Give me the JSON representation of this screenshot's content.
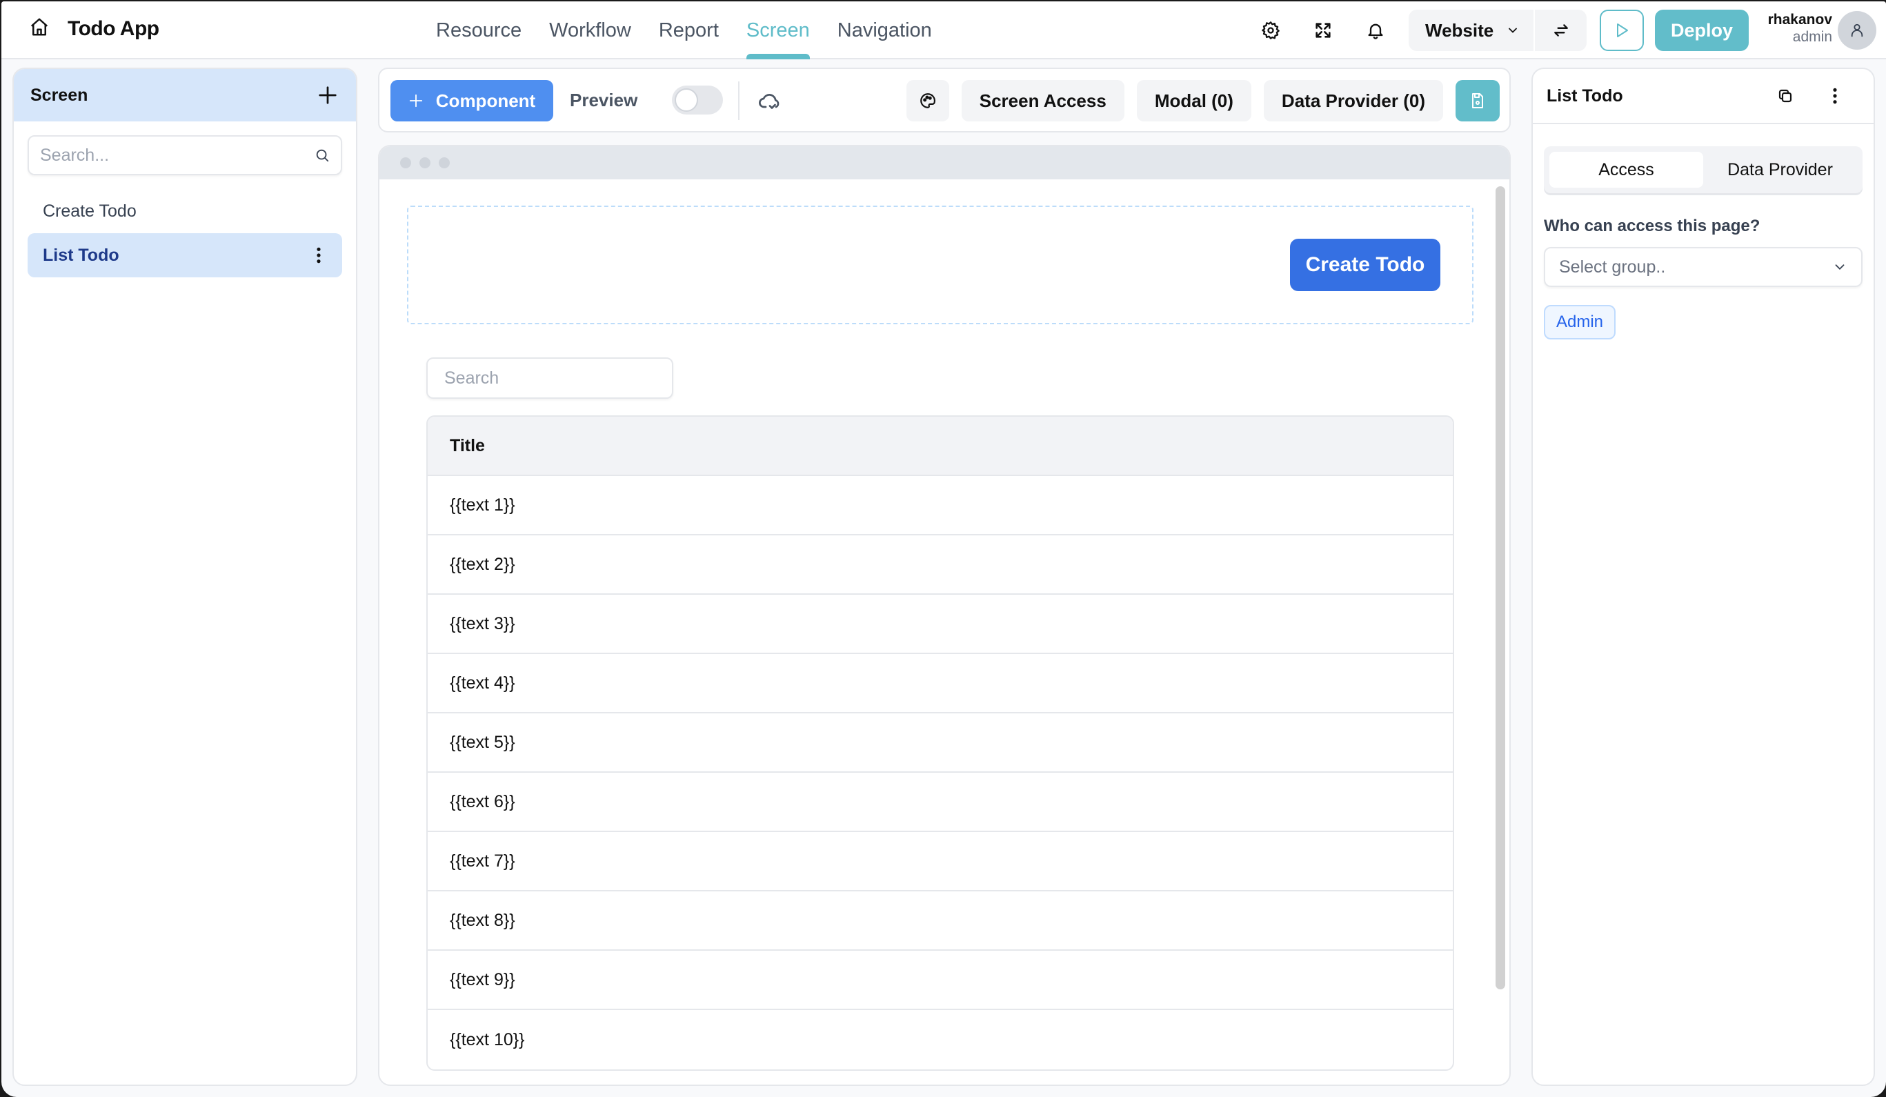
{
  "app": {
    "title": "Todo App",
    "home_icon": "home-icon"
  },
  "nav": {
    "items": [
      {
        "label": "Resource",
        "active": false
      },
      {
        "label": "Workflow",
        "active": false
      },
      {
        "label": "Report",
        "active": false
      },
      {
        "label": "Screen",
        "active": true
      },
      {
        "label": "Navigation",
        "active": false
      }
    ]
  },
  "topbar": {
    "icons": [
      "gear-icon",
      "expand-icon",
      "bell-icon"
    ],
    "environment": "Website",
    "swap_icon": "swap-arrows-icon",
    "run_icon": "play-icon",
    "deploy_label": "Deploy",
    "user": {
      "name": "rhakanov",
      "role": "admin"
    }
  },
  "left_panel": {
    "title": "Screen",
    "search_placeholder": "Search...",
    "screens": [
      {
        "label": "Create Todo",
        "active": false
      },
      {
        "label": "List Todo",
        "active": true
      }
    ]
  },
  "toolbar": {
    "component_label": "Component",
    "preview_label": "Preview",
    "preview_enabled": false,
    "theme_icon": "palette-icon",
    "screen_access_label": "Screen Access",
    "modal_label": "Modal (0)",
    "data_provider_label": "Data Provider (0)",
    "save_icon": "save-icon"
  },
  "canvas": {
    "create_button_label": "Create Todo",
    "search_placeholder": "Search",
    "table": {
      "columns": [
        "Title"
      ],
      "rows": [
        "{{text 1}}",
        "{{text 2}}",
        "{{text 3}}",
        "{{text 4}}",
        "{{text 5}}",
        "{{text 6}}",
        "{{text 7}}",
        "{{text 8}}",
        "{{text 9}}",
        "{{text 10}}"
      ]
    }
  },
  "right_panel": {
    "title": "List Todo",
    "tabs": [
      {
        "label": "Access",
        "active": true
      },
      {
        "label": "Data Provider",
        "active": false
      }
    ],
    "access_question": "Who can access this page?",
    "group_select_placeholder": "Select group..",
    "selected_groups": [
      "Admin"
    ]
  },
  "colors": {
    "accent": "#5fbcc9",
    "primary_blue": "#3570e3",
    "component_blue": "#4f8ff0",
    "selection_bg": "#d6e6fa"
  }
}
